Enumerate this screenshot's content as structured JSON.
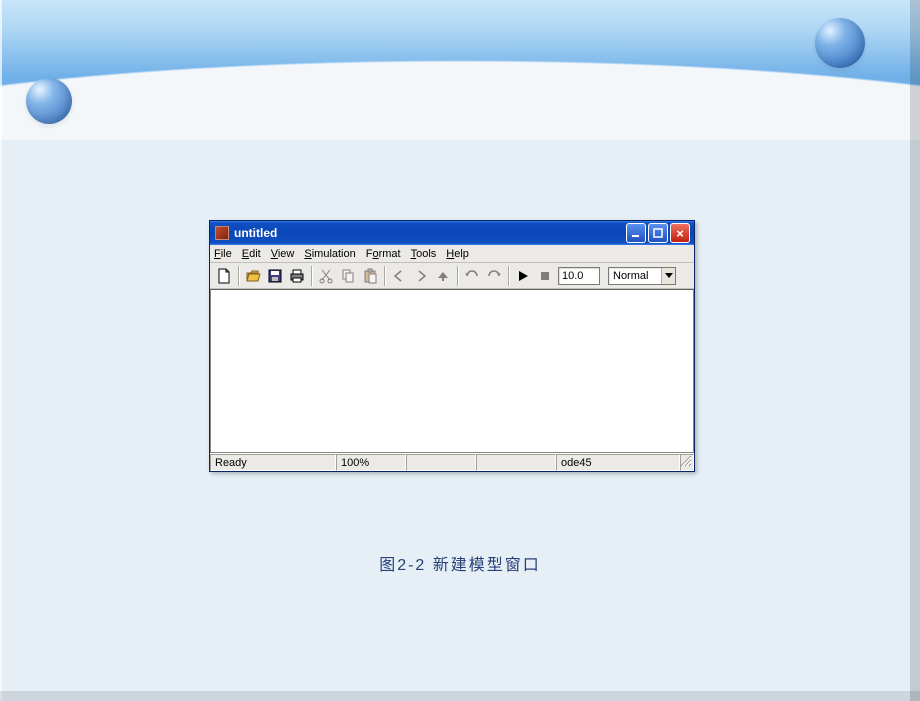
{
  "caption": "图2-2   新建模型窗口",
  "window": {
    "title": "untitled",
    "menus": {
      "file": "File",
      "edit": "Edit",
      "view": "View",
      "simulation": "Simulation",
      "format": "Format",
      "tools": "Tools",
      "help": "Help"
    },
    "toolbar": {
      "stop_time": "10.0",
      "mode_selected": "Normal"
    },
    "status": {
      "state": "Ready",
      "zoom": "100%",
      "pane3": "",
      "pane4": "",
      "solver": "ode45"
    }
  }
}
